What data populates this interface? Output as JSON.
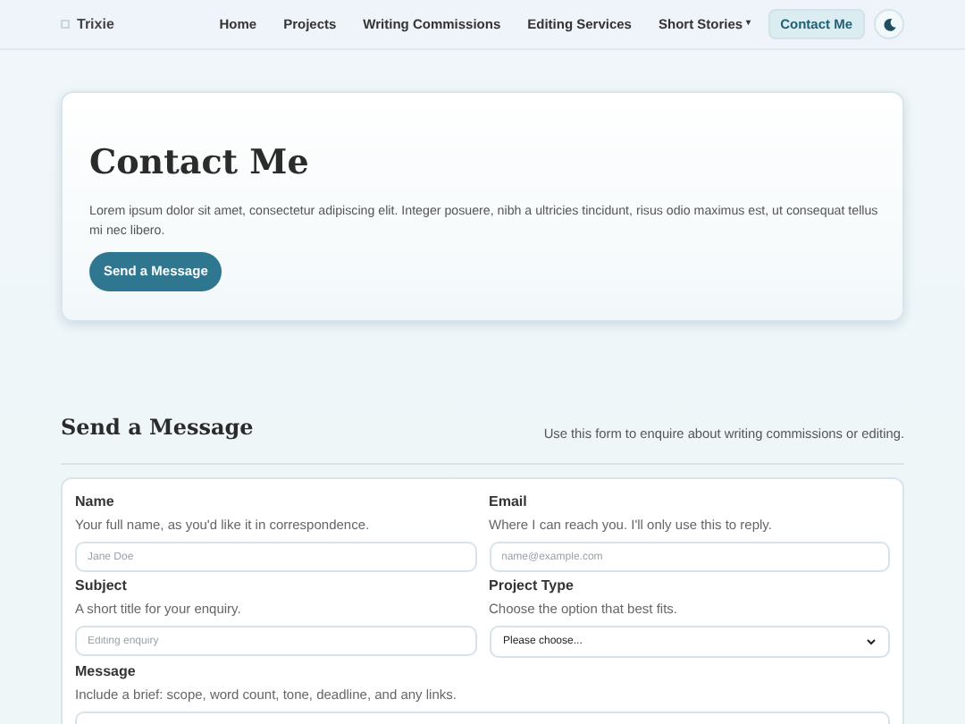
{
  "brand": {
    "name": "Trixie"
  },
  "nav": [
    {
      "label": "Home",
      "selected": false
    },
    {
      "label": "Projects",
      "selected": false
    },
    {
      "label": "Writing Commissions",
      "selected": false
    },
    {
      "label": "Editing Services",
      "selected": false
    },
    {
      "label": "Short Stories",
      "caret": "▾",
      "selected": false
    },
    {
      "label": "Contact Me",
      "selected": true
    }
  ],
  "hero": {
    "title": "Contact Me",
    "text": "Lorem ipsum dolor sit amet, consectetur adipiscing elit. Integer posuere, nibh a ultricies tincidunt, risus odio maximus est, ut consequat tellus mi nec libero.",
    "button": "Send a Message"
  },
  "section": {
    "title": "Send a Message",
    "note": "Use this form to enquire about writing commissions or editing."
  },
  "fields": [
    {
      "kind": "input",
      "label": "Name",
      "help": "Your full name, as you'd like it in correspondence.",
      "placeholder": "Jane Doe"
    },
    {
      "kind": "input",
      "label": "Email",
      "help": "Where I can reach you. I'll only use this to reply.",
      "placeholder": "name@example.com"
    },
    {
      "kind": "input",
      "label": "Subject",
      "help": "A short title for your enquiry.",
      "placeholder": "Editing enquiry"
    },
    {
      "kind": "select",
      "label": "Project Type",
      "help": "Choose the option that best fits.",
      "value": "Please choose..."
    },
    {
      "kind": "textarea",
      "label": "Message",
      "help": "Include a brief: scope, word count, tone, deadline, and any links."
    }
  ]
}
